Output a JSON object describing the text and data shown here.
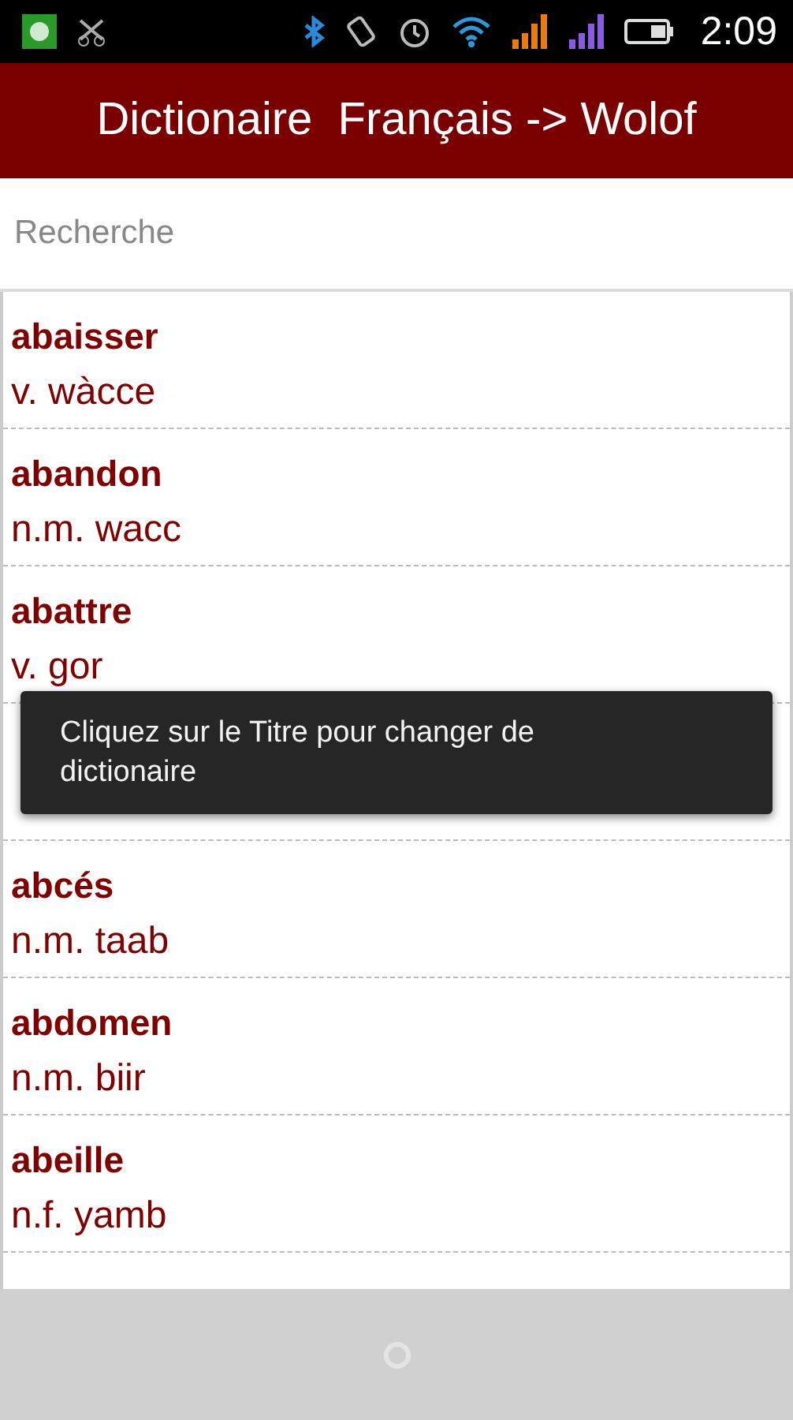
{
  "status_bar": {
    "time": "2:09"
  },
  "title": "Dictionaire  Français -> Wolof",
  "search": {
    "placeholder": "Recherche"
  },
  "entries": [
    {
      "word": "abaisser",
      "translation": "v. wàcce"
    },
    {
      "word": "abandon",
      "translation": "n.m. wacc"
    },
    {
      "word": "abattre",
      "translation": "v. gor"
    },
    {
      "covered": true
    },
    {
      "word": "abcés",
      "translation": "n.m. taab"
    },
    {
      "word": "abdomen",
      "translation": "n.m. biir"
    },
    {
      "word": "abeille",
      "translation": "n.f. yamb"
    }
  ],
  "toast": "Cliquez sur le Titre pour changer de dictionaire"
}
